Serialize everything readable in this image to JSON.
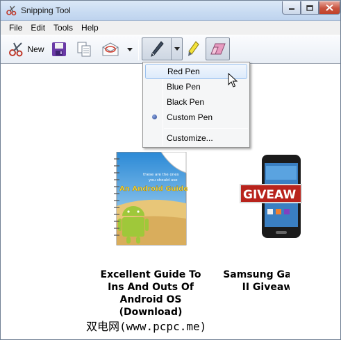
{
  "window": {
    "title": "Snipping Tool"
  },
  "menubar": {
    "items": [
      "File",
      "Edit",
      "Tools",
      "Help"
    ]
  },
  "toolbar": {
    "new_label": "New"
  },
  "pen_menu": {
    "items": [
      "Red Pen",
      "Blue Pen",
      "Black Pen",
      "Custom Pen",
      "Customize..."
    ],
    "highlighted": "Red Pen",
    "selected": "Custom Pen"
  },
  "snip": {
    "book_cover": {
      "line1": "these are the ones",
      "line2": "you should use",
      "title": "An Android Guide"
    },
    "phone_banner": "GIVEAW",
    "caption_1": "Excellent Guide To Ins And Outs Of Android OS (Download)",
    "caption_2": "Samsung Galaxy S II Giveaway",
    "watermark": "双电网(www.pcpc.me)"
  },
  "colors": {
    "titlebar": "#c8dbf2",
    "close": "#c8533f",
    "highlight": "#dceafb",
    "radio": "#26418f"
  }
}
